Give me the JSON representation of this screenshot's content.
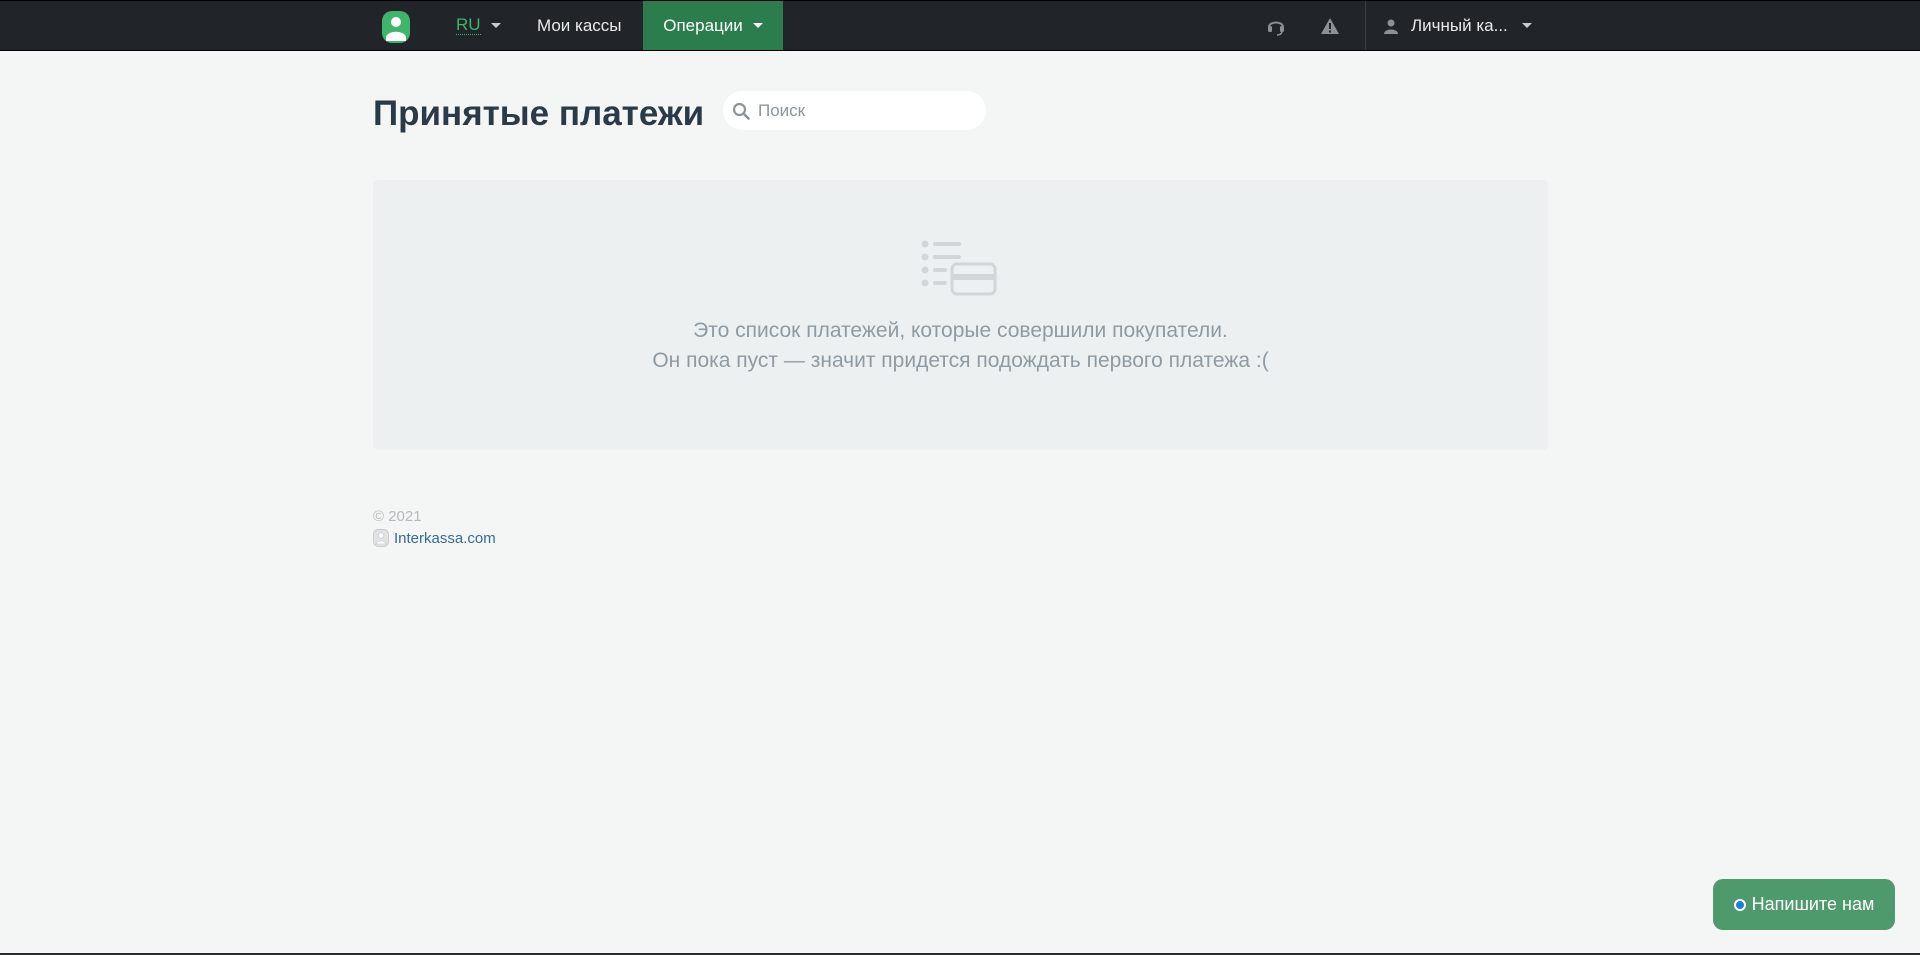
{
  "navbar": {
    "language": "RU",
    "nav_kassy": "Мои кассы",
    "nav_operations": "Операции",
    "account_label": "Личный ка..."
  },
  "page": {
    "title": "Принятые платежи",
    "search_placeholder": "Поиск"
  },
  "empty_state": {
    "line1": "Это список платежей, которые совершили покупатели.",
    "line2": "Он пока пуст — значит придется подождать первого платежа :("
  },
  "footer": {
    "copyright": "© 2021",
    "link": "Interkassa.com"
  },
  "chat": {
    "label": "Напишите нам"
  },
  "colors": {
    "navbar_bg": "#212428",
    "active_nav": "#2b7d4d",
    "brand_green": "#3fb46a",
    "chat_button": "#4f9a6d",
    "title_color": "#2b3a47"
  },
  "icons": {
    "logo": "interkassa-logo-icon",
    "support": "headset-icon",
    "alert": "warning-icon",
    "account": "user-icon",
    "search": "search-icon",
    "empty": "list-card-icon"
  }
}
